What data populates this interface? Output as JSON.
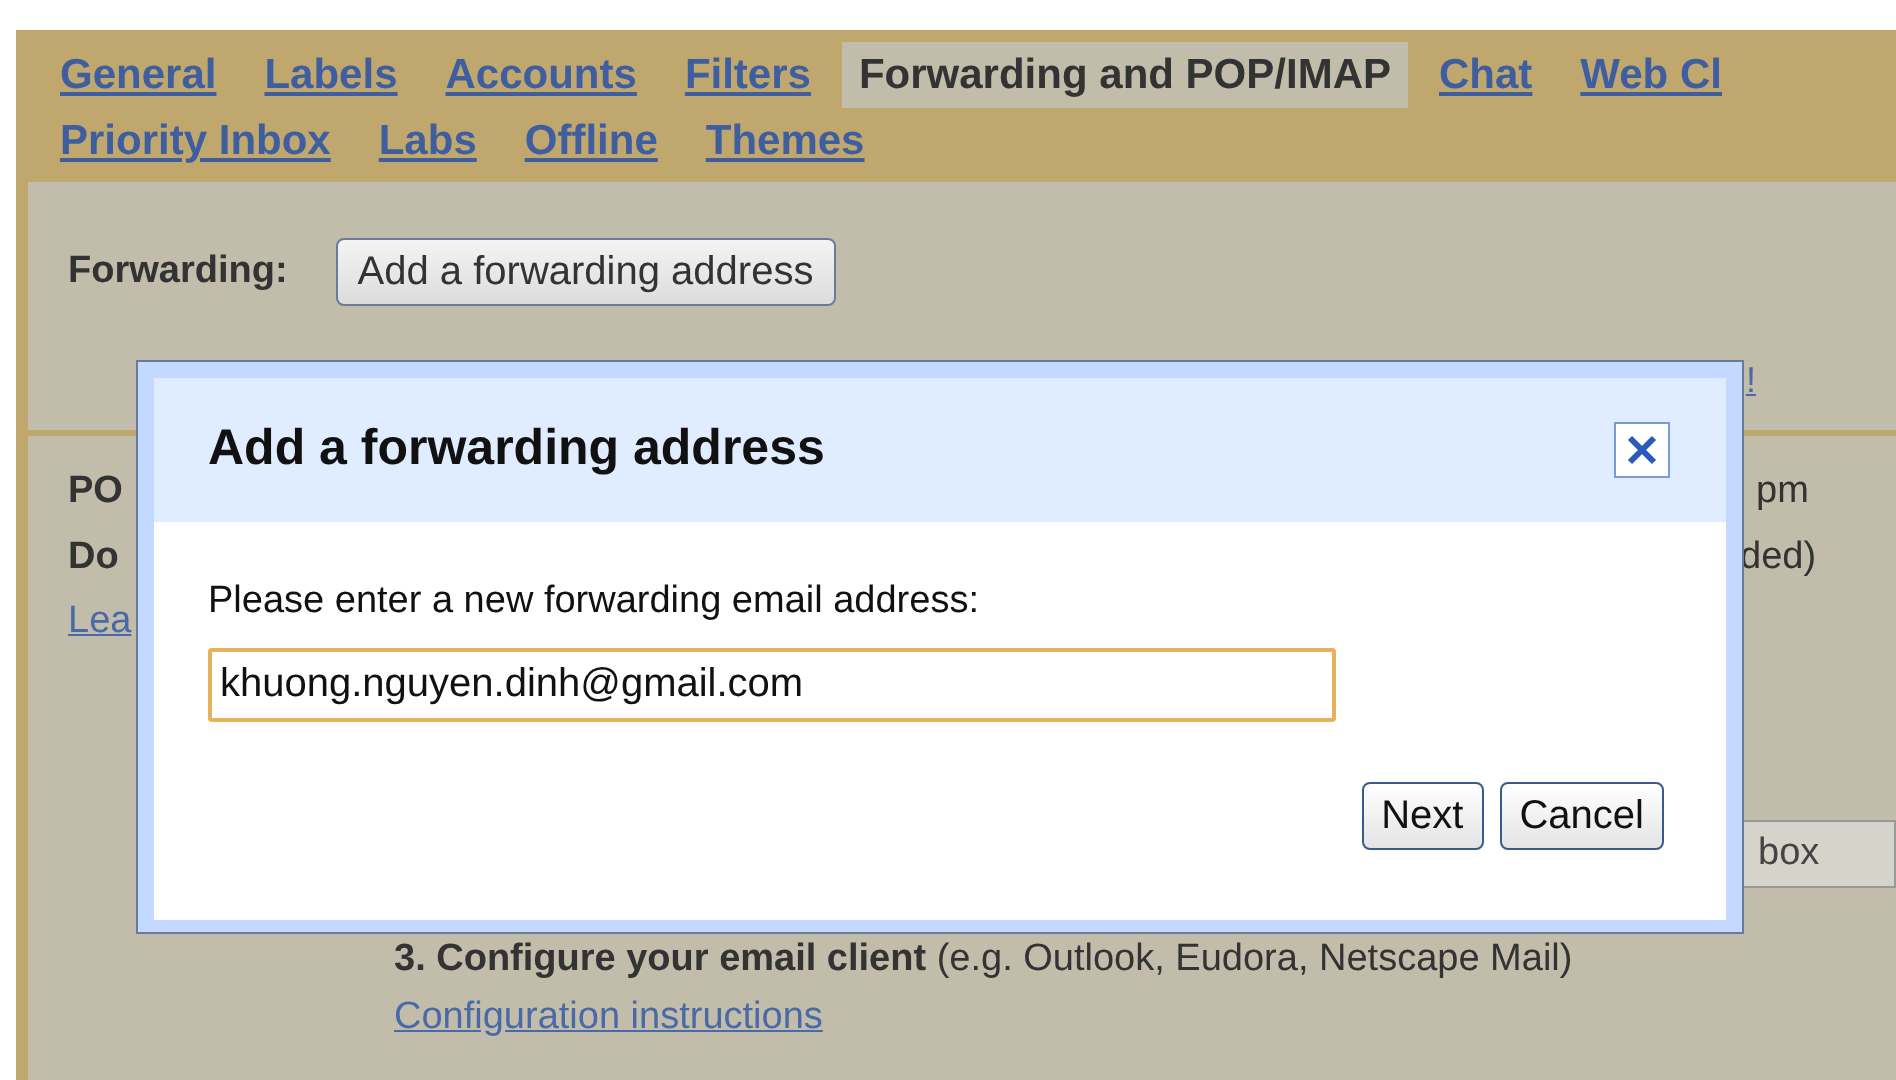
{
  "tab_rows": [
    {
      "tabs": [
        {
          "label": "General",
          "selected": false
        },
        {
          "label": "Labels",
          "selected": false
        },
        {
          "label": "Accounts",
          "selected": false
        },
        {
          "label": "Filters",
          "selected": false
        },
        {
          "label": "Forwarding and POP/IMAP",
          "selected": true
        },
        {
          "label": "Chat",
          "selected": false
        },
        {
          "label": "Web Cl",
          "selected": false
        }
      ]
    },
    {
      "tabs": [
        {
          "label": "Priority Inbox",
          "selected": false
        },
        {
          "label": "Labs",
          "selected": false
        },
        {
          "label": "Offline",
          "selected": false
        },
        {
          "label": "Themes",
          "selected": false
        }
      ]
    }
  ],
  "forwarding": {
    "label": "Forwarding:",
    "button": "Add a forwarding address"
  },
  "partial_link": "!",
  "pop_label": "PO",
  "time_text": "pm",
  "download_label": "Do",
  "status_text": "ded)",
  "learn_link": "Lea",
  "select_value": "box",
  "step_3": {
    "text": "**3. Configure your email client** (e.g. Outlook, Eudora, Netscape Mail)",
    "link": "Configuration instructions"
  },
  "dialog": {
    "title": "Add a forwarding address",
    "prompt": "Please enter a new forwarding email address:",
    "value": "khuong.nguyen.dinh@gmail.com",
    "buttons": [
      "Next",
      "Cancel"
    ]
  }
}
